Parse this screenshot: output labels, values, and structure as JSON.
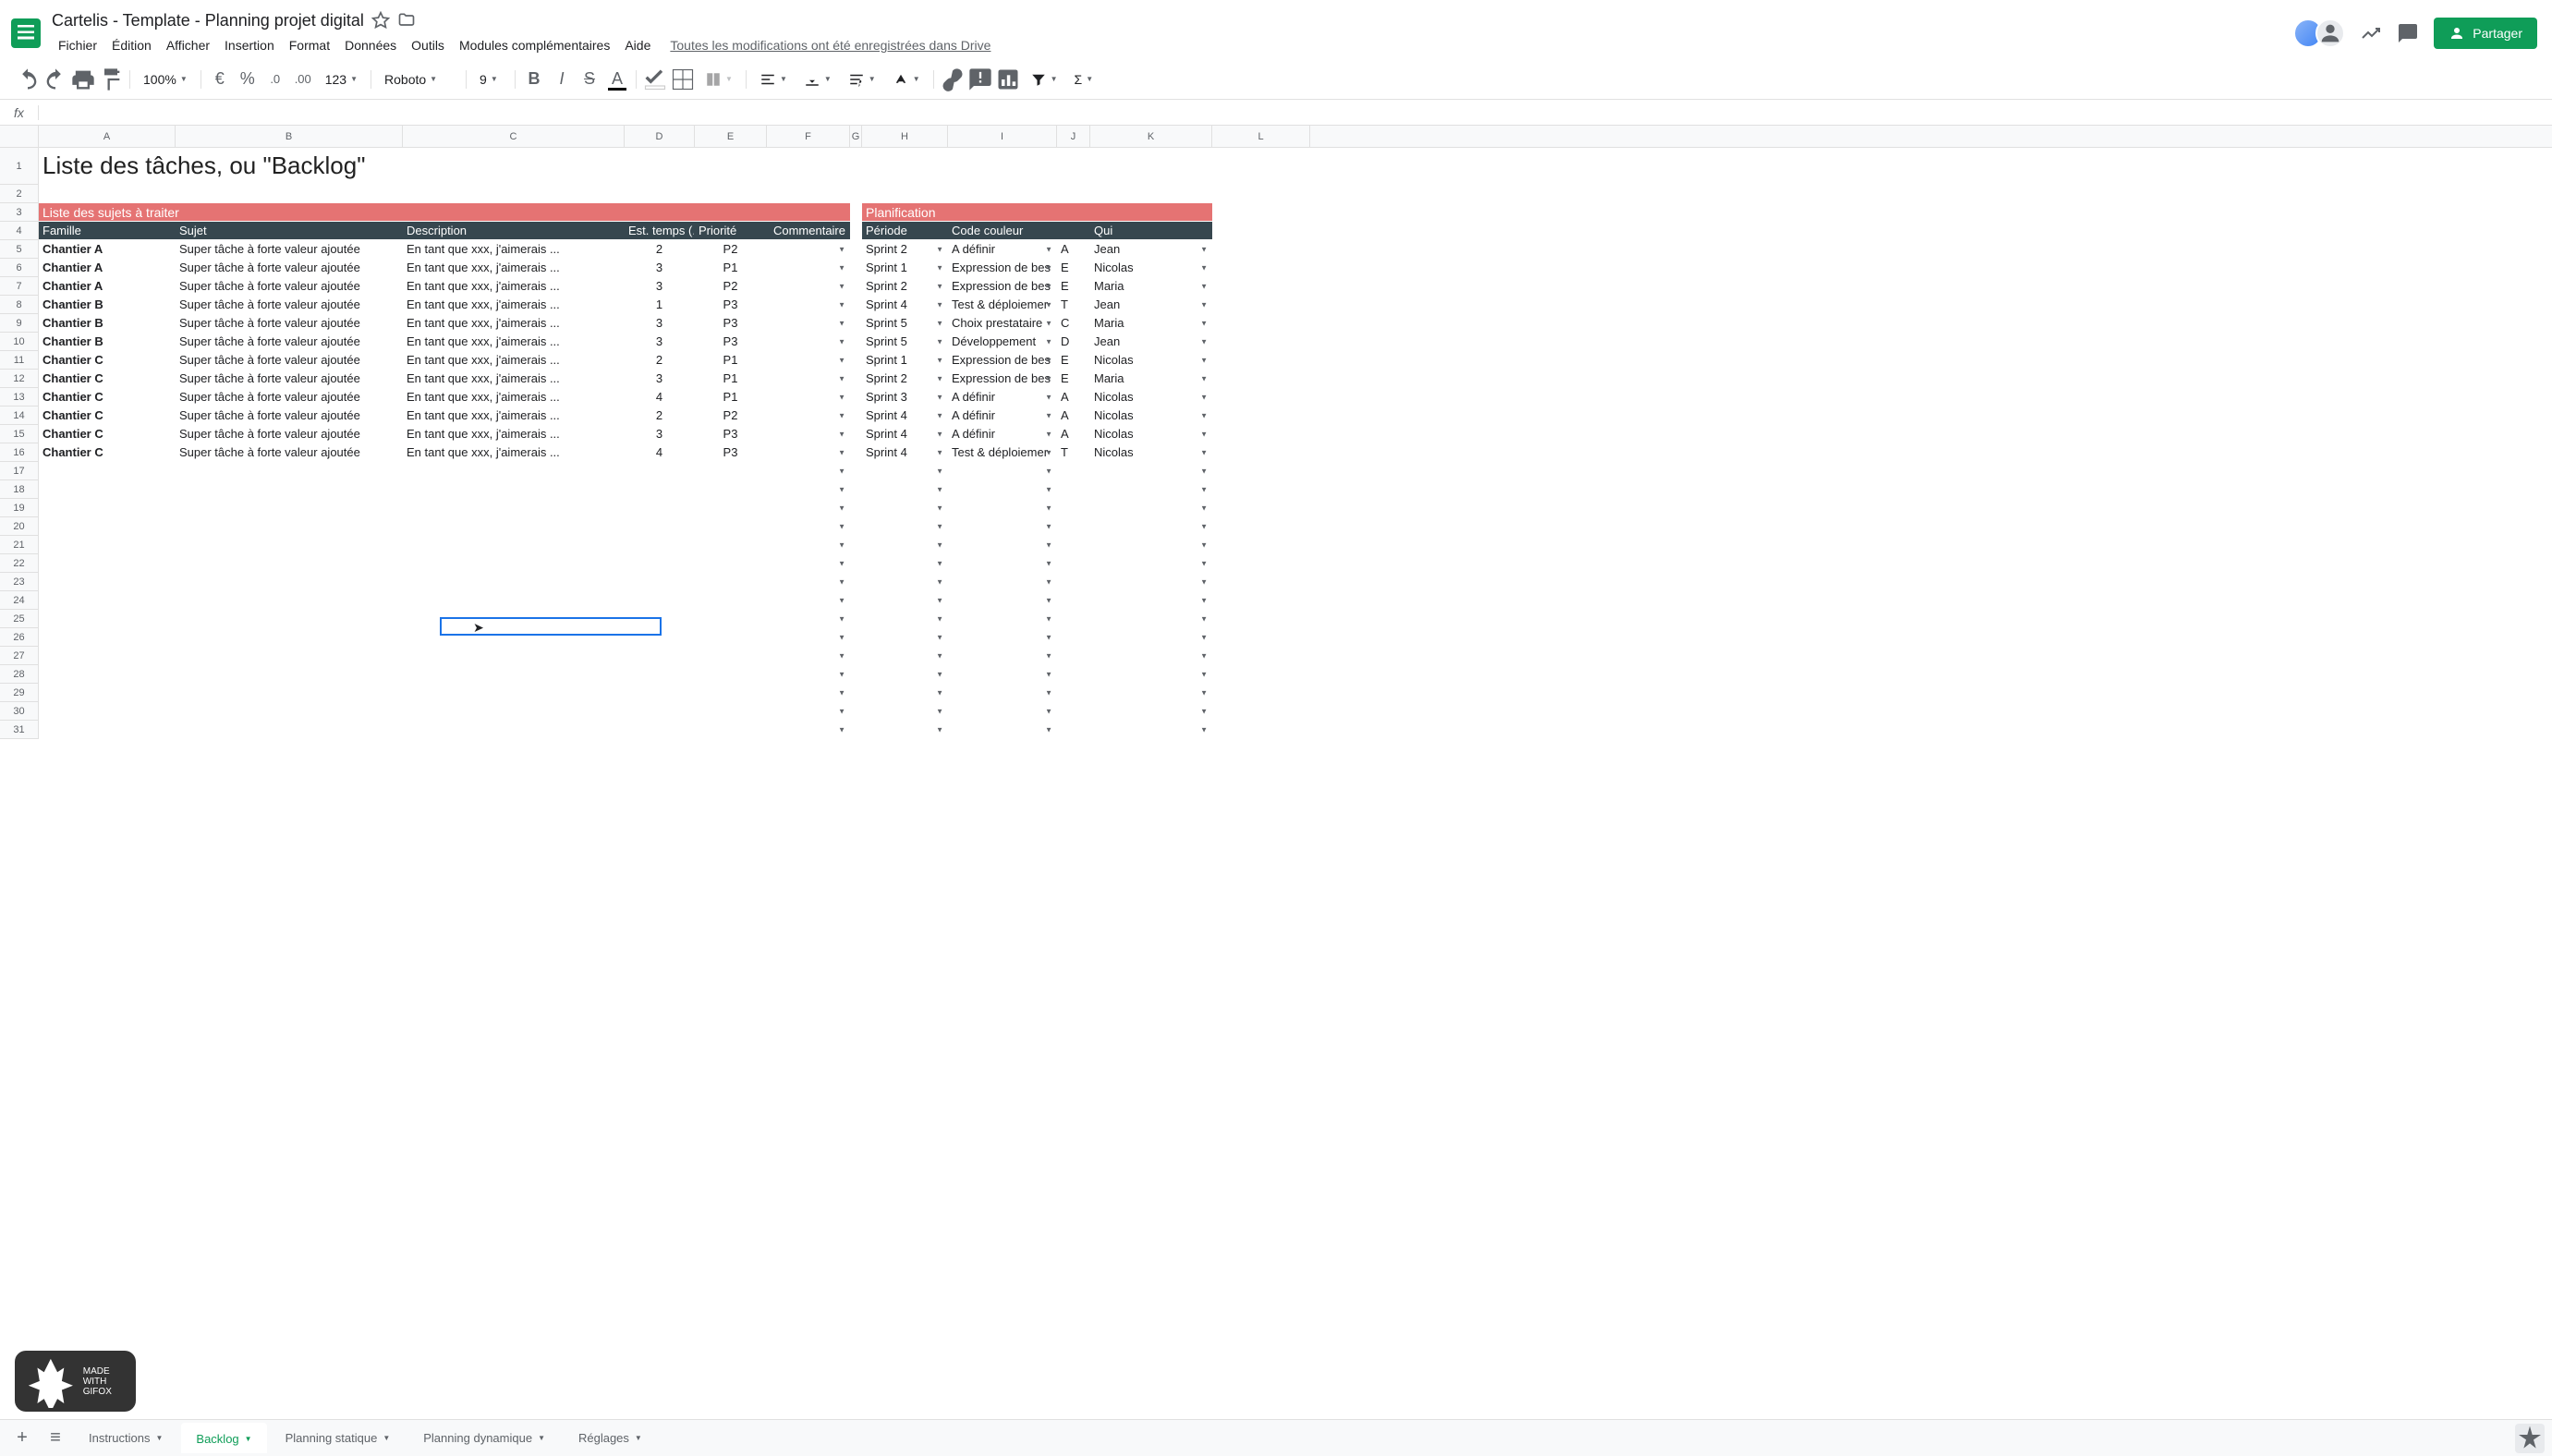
{
  "doc": {
    "title": "Cartelis -  Template - Planning projet digital",
    "save_status": "Toutes les modifications ont été enregistrées dans Drive"
  },
  "menu": [
    "Fichier",
    "Édition",
    "Afficher",
    "Insertion",
    "Format",
    "Données",
    "Outils",
    "Modules complémentaires",
    "Aide"
  ],
  "share_label": "Partager",
  "toolbar": {
    "zoom": "100%",
    "format_123": "123",
    "font": "Roboto",
    "size": "9"
  },
  "sheet": {
    "title": "Liste des tâches, ou \"Backlog\"",
    "section1": "Liste des sujets à traiter",
    "section2": "Planification",
    "headers1": [
      "Famille",
      "Sujet",
      "Description",
      "Est. temps (.",
      "Priorité",
      "Commentaire"
    ],
    "headers2": [
      "Période",
      "Code couleur",
      "",
      "Qui"
    ],
    "rows": [
      {
        "famille": "Chantier A",
        "sujet": "Super tâche à forte valeur ajoutée",
        "desc": "En tant que xxx, j'aimerais ...",
        "est": "2",
        "prio": "P2",
        "periode": "Sprint 2",
        "code": "A définir",
        "cc": "A",
        "qui": "Jean"
      },
      {
        "famille": "Chantier A",
        "sujet": "Super tâche à forte valeur ajoutée",
        "desc": "En tant que xxx, j'aimerais ...",
        "est": "3",
        "prio": "P1",
        "periode": "Sprint 1",
        "code": "Expression de bes",
        "cc": "E",
        "qui": "Nicolas"
      },
      {
        "famille": "Chantier A",
        "sujet": "Super tâche à forte valeur ajoutée",
        "desc": "En tant que xxx, j'aimerais ...",
        "est": "3",
        "prio": "P2",
        "periode": "Sprint 2",
        "code": "Expression de bes",
        "cc": "E",
        "qui": "Maria"
      },
      {
        "famille": "Chantier B",
        "sujet": "Super tâche à forte valeur ajoutée",
        "desc": "En tant que xxx, j'aimerais ...",
        "est": "1",
        "prio": "P3",
        "periode": "Sprint 4",
        "code": "Test & déploiemer",
        "cc": "T",
        "qui": "Jean"
      },
      {
        "famille": "Chantier B",
        "sujet": "Super tâche à forte valeur ajoutée",
        "desc": "En tant que xxx, j'aimerais ...",
        "est": "3",
        "prio": "P3",
        "periode": "Sprint 5",
        "code": "Choix prestataire",
        "cc": "C",
        "qui": "Maria"
      },
      {
        "famille": "Chantier B",
        "sujet": "Super tâche à forte valeur ajoutée",
        "desc": "En tant que xxx, j'aimerais ...",
        "est": "3",
        "prio": "P3",
        "periode": "Sprint 5",
        "code": "Développement",
        "cc": "D",
        "qui": "Jean"
      },
      {
        "famille": "Chantier C",
        "sujet": "Super tâche à forte valeur ajoutée",
        "desc": "En tant que xxx, j'aimerais ...",
        "est": "2",
        "prio": "P1",
        "periode": "Sprint 1",
        "code": "Expression de bes",
        "cc": "E",
        "qui": "Nicolas"
      },
      {
        "famille": "Chantier C",
        "sujet": "Super tâche à forte valeur ajoutée",
        "desc": "En tant que xxx, j'aimerais ...",
        "est": "3",
        "prio": "P1",
        "periode": "Sprint 2",
        "code": "Expression de bes",
        "cc": "E",
        "qui": "Maria"
      },
      {
        "famille": "Chantier C",
        "sujet": "Super tâche à forte valeur ajoutée",
        "desc": "En tant que xxx, j'aimerais ...",
        "est": "4",
        "prio": "P1",
        "periode": "Sprint 3",
        "code": "A définir",
        "cc": "A",
        "qui": "Nicolas"
      },
      {
        "famille": "Chantier C",
        "sujet": "Super tâche à forte valeur ajoutée",
        "desc": "En tant que xxx, j'aimerais ...",
        "est": "2",
        "prio": "P2",
        "periode": "Sprint 4",
        "code": "A définir",
        "cc": "A",
        "qui": "Nicolas"
      },
      {
        "famille": "Chantier C",
        "sujet": "Super tâche à forte valeur ajoutée",
        "desc": "En tant que xxx, j'aimerais ...",
        "est": "3",
        "prio": "P3",
        "periode": "Sprint 4",
        "code": "A définir",
        "cc": "A",
        "qui": "Nicolas"
      },
      {
        "famille": "Chantier C",
        "sujet": "Super tâche à forte valeur ajoutée",
        "desc": "En tant que xxx, j'aimerais ...",
        "est": "4",
        "prio": "P3",
        "periode": "Sprint 4",
        "code": "Test & déploiemer",
        "cc": "T",
        "qui": "Nicolas"
      }
    ],
    "columns": [
      "A",
      "B",
      "C",
      "D",
      "E",
      "F",
      "G",
      "H",
      "I",
      "J",
      "K",
      "L"
    ],
    "empty_rows": 15
  },
  "tabs": [
    "Instructions",
    "Backlog",
    "Planning statique",
    "Planning dynamique",
    "Réglages"
  ],
  "active_tab": 1,
  "watermark": "MADE WITH GIFOX"
}
